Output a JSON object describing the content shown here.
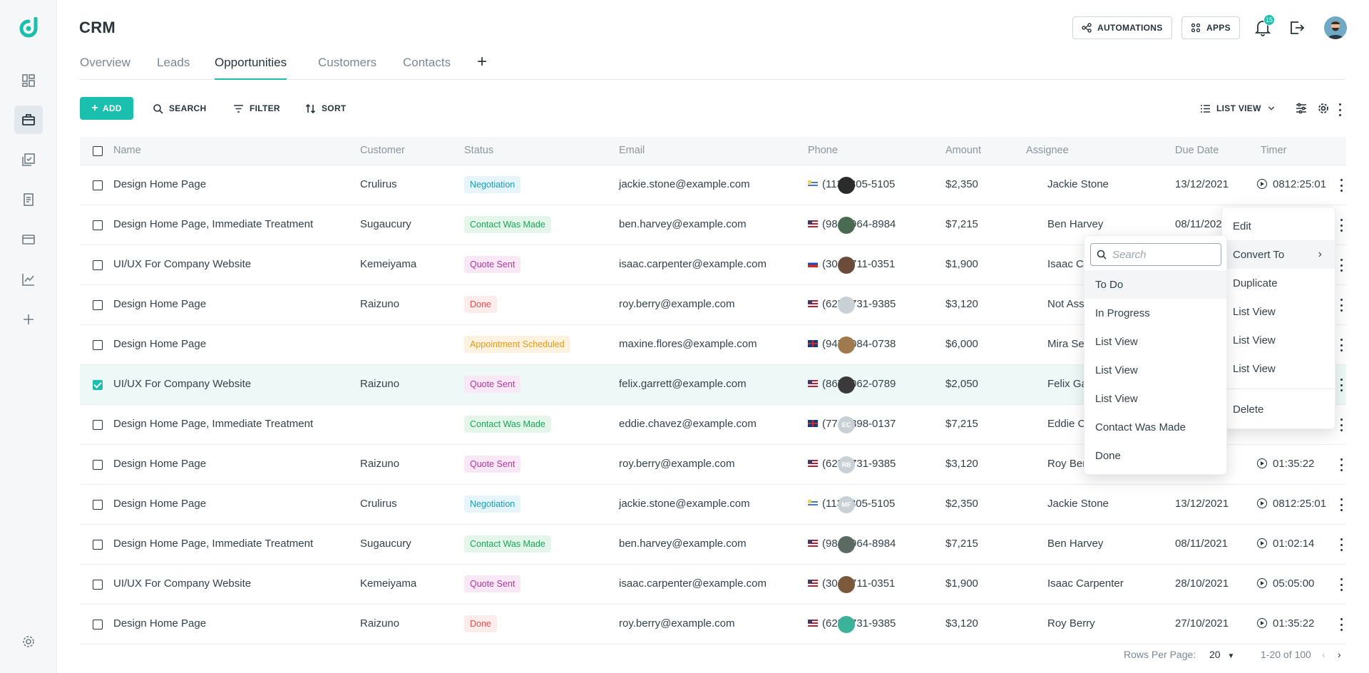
{
  "app": {
    "title": "CRM"
  },
  "header": {
    "automations_label": "AUTOMATIONS",
    "apps_label": "APPS",
    "notification_count": "15"
  },
  "tabs": [
    {
      "label": "Overview"
    },
    {
      "label": "Leads"
    },
    {
      "label": "Opportunities",
      "active": true
    },
    {
      "label": "Customers"
    },
    {
      "label": "Contacts"
    }
  ],
  "toolbar": {
    "add_label": "ADD",
    "search_label": "SEARCH",
    "filter_label": "FILTER",
    "sort_label": "SORT",
    "view_label": "LIST VIEW"
  },
  "table": {
    "columns": [
      "Name",
      "Customer",
      "Status",
      "Email",
      "Phone",
      "Amount",
      "Assignee",
      "Due Date",
      "Timer"
    ],
    "rows": [
      {
        "name": "Design Home Page",
        "customer": "Crulirus",
        "status": "Negotiation",
        "email": "jackie.stone@example.com",
        "phone": "(113)-305-5105",
        "amount": "$2,350",
        "assignee": "Jackie Stone",
        "due": "13/12/2021",
        "timer": "0812:25:01"
      },
      {
        "name": "Design Home Page, Immediate Treatment",
        "customer": "Sugaucury",
        "status": "Contact Was Made",
        "email": "ben.harvey@example.com",
        "phone": "(984)-964-8984",
        "amount": "$7,215",
        "assignee": "Ben Harvey",
        "due": "08/11/202",
        "timer": ""
      },
      {
        "name": "UI/UX For Company Website",
        "customer": "Kemeiyama",
        "status": "Quote Sent",
        "email": "isaac.carpenter@example.com",
        "phone": "(301)-711-0351",
        "amount": "$1,900",
        "assignee": "Isaac C",
        "due": "",
        "timer": ""
      },
      {
        "name": "Design Home Page",
        "customer": "Raizuno",
        "status": "Done",
        "email": "roy.berry@example.com",
        "phone": "(625)-731-9385",
        "amount": "$3,120",
        "assignee": "Not Ass",
        "due": "",
        "timer": ""
      },
      {
        "name": "Design Home Page",
        "customer": "",
        "status": "Appointment Scheduled",
        "email": "maxine.flores@example.com",
        "phone": "(947)-084-0738",
        "amount": "$6,000",
        "assignee": "Mira Se",
        "due": "",
        "timer": ""
      },
      {
        "name": "UI/UX For Company Website",
        "customer": "Raizuno",
        "status": "Quote Sent",
        "email": "felix.garrett@example.com",
        "phone": "(867)-062-0789",
        "amount": "$2,050",
        "assignee": "Felix Ga",
        "due": "",
        "timer": "",
        "selected": true
      },
      {
        "name": "Design Home Page, Immediate Treatment",
        "customer": "",
        "status": "Contact Was Made",
        "email": "eddie.chavez@example.com",
        "phone": "(774)-898-0137",
        "amount": "$7,215",
        "assignee": "Eddie C",
        "initials": "EC",
        "due": "",
        "timer": ""
      },
      {
        "name": "Design Home Page",
        "customer": "Raizuno",
        "status": "Quote Sent",
        "email": "roy.berry@example.com",
        "phone": "(625)-731-9385",
        "amount": "$3,120",
        "assignee": "Roy Ber",
        "initials": "RB",
        "due": "",
        "timer": "01:35:22"
      },
      {
        "name": "Design Home Page",
        "customer": "Crulirus",
        "status": "Negotiation",
        "email": "jackie.stone@example.com",
        "phone": "(113)-305-5105",
        "amount": "$2,350",
        "assignee": "Jackie Stone",
        "initials": "MF",
        "due": "13/12/2021",
        "timer": "0812:25:01"
      },
      {
        "name": "Design Home Page, Immediate Treatment",
        "customer": "Sugaucury",
        "status": "Contact Was Made",
        "email": "ben.harvey@example.com",
        "phone": "(984)-964-8984",
        "amount": "$7,215",
        "assignee": "Ben Harvey",
        "due": "08/11/2021",
        "timer": "01:02:14"
      },
      {
        "name": "UI/UX For Company Website",
        "customer": "Kemeiyama",
        "status": "Quote Sent",
        "email": "isaac.carpenter@example.com",
        "phone": "(301)-711-0351",
        "amount": "$1,900",
        "assignee": "Isaac Carpenter",
        "due": "28/10/2021",
        "timer": "05:05:00"
      },
      {
        "name": "Design Home Page",
        "customer": "Raizuno",
        "status": "Done",
        "email": "roy.berry@example.com",
        "phone": "(625)-731-9385",
        "amount": "$3,120",
        "assignee": "Roy Berry",
        "due": "27/10/2021",
        "timer": "01:35:22"
      }
    ]
  },
  "context_menu": {
    "items": [
      "Edit",
      "Convert To",
      "Duplicate",
      "List View",
      "List View",
      "List View",
      "Delete"
    ]
  },
  "submenu": {
    "search_placeholder": "Search",
    "items": [
      "To Do",
      "In Progress",
      "List View",
      "List View",
      "List View",
      "Contact Was Made",
      "Done"
    ]
  },
  "footer": {
    "rows_per_page_label": "Rows Per Page:",
    "rows_per_page_value": "20",
    "range": "1-20 of 100"
  },
  "colors": {
    "accent": "#1bbfae",
    "negotiation": "#1e9bb5",
    "contact_was_made": "#19a55a",
    "quote_sent": "#b2389e",
    "done": "#e05050",
    "appointment_scheduled": "#e39a1c"
  }
}
